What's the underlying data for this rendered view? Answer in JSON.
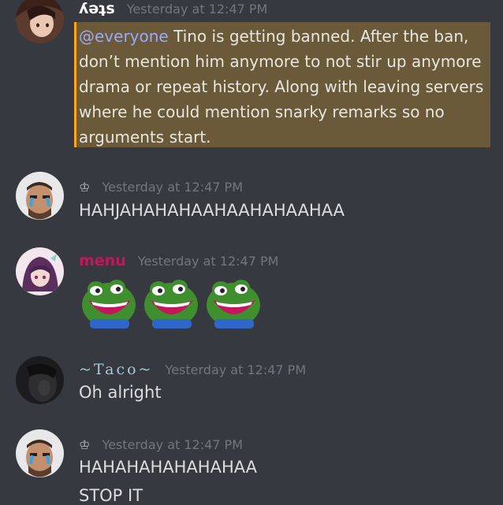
{
  "messages": [
    {
      "username": "ʎǝʇs",
      "timestamp": "Yesterday at 12:47 PM",
      "mention": "@everyone",
      "text": " Tino is getting banned. After the ban, don’t mention him anymore to not stir up anymore drama or repeat history. Along with leaving servers where he could mention snarky remarks so no arguments start."
    },
    {
      "badge": "♔",
      "timestamp": "Yesterday at 12:47 PM",
      "text": "HAHJAHAHAHAAHAAHAHAAHAA"
    },
    {
      "username": "menu",
      "timestamp": "Yesterday at 12:47 PM",
      "emotes": [
        "pepe-laugh-emote",
        "pepe-laugh-emote",
        "pepe-laugh-emote"
      ]
    },
    {
      "username": "~Taco~",
      "timestamp": "Yesterday at 12:47 PM",
      "text": "Oh alright"
    },
    {
      "badge": "♔",
      "timestamp": "Yesterday at 12:47 PM",
      "text": "HAHAHAHAHAHAHAA",
      "text2": "STOP IT"
    }
  ],
  "colors": {
    "background": "#36393f",
    "timestamp": "#72767d",
    "mention_highlight": "#6a5a3a",
    "mention_border": "#faa61a",
    "menu_name": "#c2185b",
    "taco_name": "#a9c6d6"
  }
}
